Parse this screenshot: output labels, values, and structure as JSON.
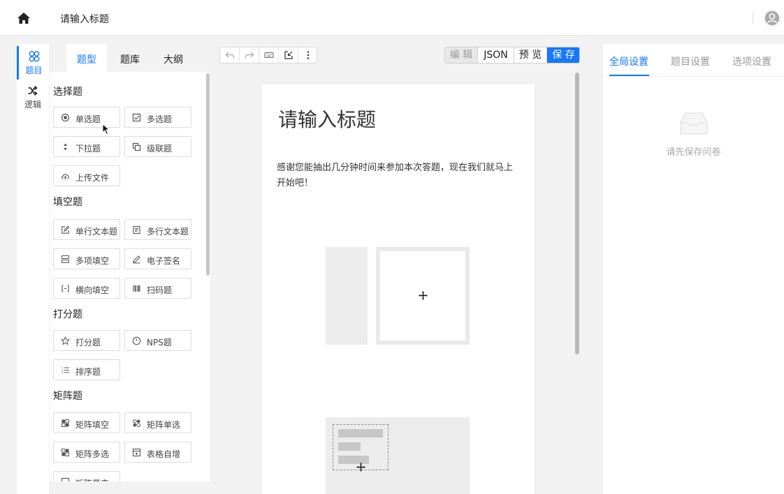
{
  "header": {
    "title": "请输入标题",
    "home_icon": "home-icon",
    "avatar_icon": "user-avatar-icon"
  },
  "rail": {
    "items": [
      {
        "label": "题目",
        "icon": "question-icon",
        "active": true
      },
      {
        "label": "逻辑",
        "icon": "shuffle-icon",
        "active": false
      }
    ]
  },
  "panel": {
    "tabs": [
      {
        "label": "题型",
        "active": true
      },
      {
        "label": "题库",
        "active": false
      },
      {
        "label": "大纲",
        "active": false
      }
    ],
    "groups": [
      {
        "title": "选择题",
        "items": [
          "单选题",
          "多选题",
          "下拉题",
          "级联题",
          "上传文件"
        ]
      },
      {
        "title": "填空题",
        "items": [
          "单行文本题",
          "多行文本题",
          "多项填空",
          "电子签名",
          "横向填空",
          "扫码题"
        ]
      },
      {
        "title": "打分题",
        "items": [
          "打分题",
          "NPS题",
          "排序题"
        ]
      },
      {
        "title": "矩阵题",
        "items": [
          "矩阵填空",
          "矩阵单选",
          "矩阵多选",
          "表格自增",
          "矩阵量表"
        ]
      }
    ]
  },
  "toolbar": {
    "tools": [
      "undo-icon",
      "redo-icon",
      "keyboard-icon",
      "import-icon",
      "more-icon"
    ],
    "modes": [
      {
        "label": "编 辑",
        "state": "disabled"
      },
      {
        "label": "JSON",
        "state": "normal"
      },
      {
        "label": "预 览",
        "state": "normal"
      },
      {
        "label": "保 存",
        "state": "primary"
      }
    ]
  },
  "survey": {
    "title": "请输入标题",
    "description": "感谢您能抽出几分钟时间来参加本次答题，现在我们就马上开始吧！"
  },
  "settings": {
    "tabs": [
      {
        "label": "全局设置",
        "active": true
      },
      {
        "label": "题目设置",
        "active": false
      },
      {
        "label": "选项设置",
        "active": false
      }
    ],
    "empty_text": "请先保存问卷",
    "empty_icon": "inbox-empty-icon"
  },
  "colors": {
    "accent": "#1677ff",
    "background": "#f2f2f3"
  }
}
